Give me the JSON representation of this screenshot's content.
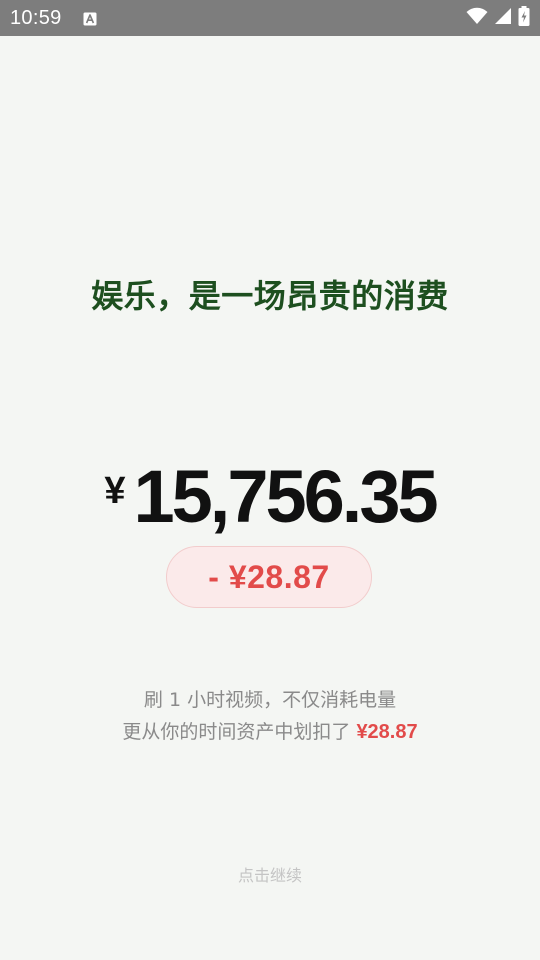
{
  "status_bar": {
    "time": "10:59",
    "icons": [
      "notification-a-icon",
      "wifi-icon",
      "signal-icon",
      "battery-charging-icon"
    ]
  },
  "headline": "娱乐，是一场昂贵的消费",
  "balance": {
    "currency": "¥",
    "value": "15,756.35"
  },
  "cost_pill": "- ¥28.87",
  "description": {
    "line1": "刷 1 小时视频，不仅消耗电量",
    "line2_prefix": "更从你的时间资产中划扣了 ",
    "line2_amount": "¥28.87"
  },
  "continue_label": "点击继续",
  "colors": {
    "background": "#f4f6f3",
    "status_bar": "#7d7d7d",
    "headline": "#1d4f1f",
    "balance": "#111111",
    "accent_red": "#e24b4a",
    "pill_bg": "#fbeaea",
    "muted_text": "#8a8a8a",
    "hint_text": "#c4c4c4"
  }
}
